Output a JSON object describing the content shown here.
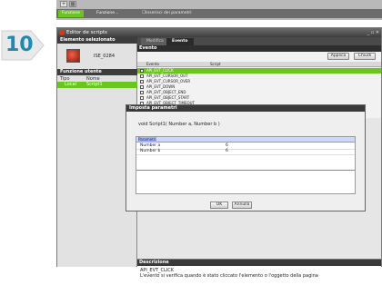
{
  "top_strip": {
    "tabs": [
      "Funzione",
      "Funzione..."
    ],
    "hint": "Inserisci dei parametri",
    "add_glyph": "+",
    "grid_glyph": "▦"
  },
  "step_badge": {
    "number": "10",
    "color": "#1e8ab4"
  },
  "window": {
    "title": "Editor de scripts",
    "controls": "_ ▫ ✕"
  },
  "left": {
    "selected_header": "Elemento selezionato",
    "element_id": "ISE_0284",
    "functions_header": "Funzione utente",
    "columns": [
      "Tipo",
      "Nome"
    ],
    "function_row": {
      "type": "Local",
      "name": "Script1"
    }
  },
  "tabs": [
    "Modifica",
    "Evento"
  ],
  "events": {
    "header": "Evento",
    "apply_label": "Applica",
    "close_label": "Chiudi",
    "columns": [
      "Evento",
      "Script"
    ],
    "rows": [
      "API_EVT_CLICK",
      "API_EVT_CURSOR_OUT",
      "API_EVT_CURSOR_OVER",
      "API_EVT_DOWN",
      "API_EVT_OBJECT_END",
      "API_EVT_OBJECT_START",
      "API_EVT_OBJECT_TIMEOUT"
    ],
    "selected_index": 0
  },
  "dialog": {
    "title": "Imposta parametri",
    "signature": "void Script1( Number a, Number b )",
    "grid_header": "Parametri",
    "params": [
      {
        "name": "Number a",
        "value": "6"
      },
      {
        "name": "Number b",
        "value": "6"
      }
    ],
    "ok_label": "OK",
    "cancel_label": "Annulla"
  },
  "description": {
    "header": "Descrizione",
    "event": "API_EVT_CLICK",
    "text": "L'evento si verifica quando è stato cliccato l'elemento o l'oggetto della pagina"
  },
  "colors": {
    "accent_green": "#6ac61e",
    "dark_header": "#3a3a3a",
    "title_icon": "#d43a1a"
  }
}
